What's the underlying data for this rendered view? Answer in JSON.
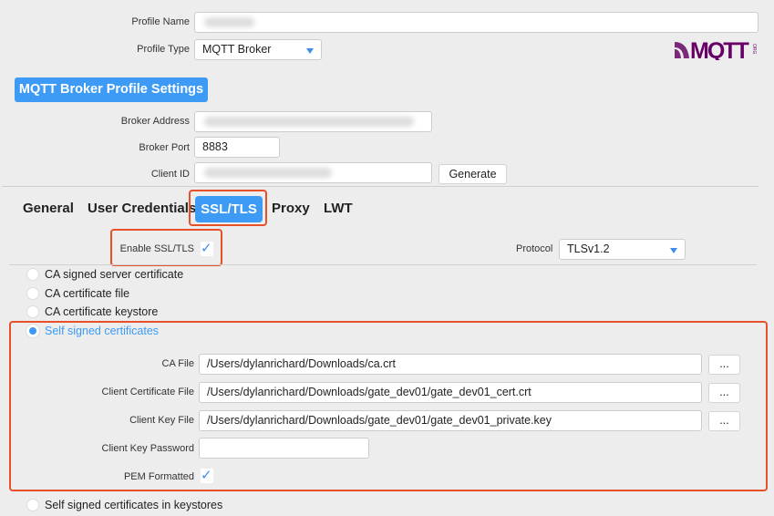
{
  "profile": {
    "name_label": "Profile Name",
    "type_label": "Profile Type",
    "type_value": "MQTT Broker"
  },
  "logo": {
    "text": "MQTT",
    "sub": "ORG",
    "colors": [
      "#660066",
      "#8a2b8a"
    ]
  },
  "section_button": "MQTT Broker Profile Settings",
  "broker": {
    "address_label": "Broker Address",
    "port_label": "Broker Port",
    "port_value": "8883",
    "client_id_label": "Client ID",
    "generate_label": "Generate"
  },
  "tabs": [
    {
      "label": "General"
    },
    {
      "label": "User Credentials"
    },
    {
      "label": "SSL/TLS",
      "active": true
    },
    {
      "label": "Proxy"
    },
    {
      "label": "LWT"
    }
  ],
  "ssl": {
    "enable_label": "Enable SSL/TLS",
    "enabled": true,
    "protocol_label": "Protocol",
    "protocol_value": "TLSv1.2"
  },
  "options": [
    {
      "label": "CA signed server certificate",
      "selected": false
    },
    {
      "label": "CA certificate file",
      "selected": false
    },
    {
      "label": "CA certificate keystore",
      "selected": false
    },
    {
      "label": "Self signed certificates",
      "selected": true
    },
    {
      "label": "Self signed certificates in keystores",
      "selected": false
    }
  ],
  "self_signed": {
    "ca_file_label": "CA File",
    "ca_file": "/Users/dylanrichard/Downloads/ca.crt",
    "client_cert_label": "Client Certificate File",
    "client_cert": "/Users/dylanrichard/Downloads/gate_dev01/gate_dev01_cert.crt",
    "client_key_label": "Client Key File",
    "client_key": "/Users/dylanrichard/Downloads/gate_dev01/gate_dev01_private.key",
    "password_label": "Client Key Password",
    "password": "",
    "pem_label": "PEM Formatted",
    "pem": true,
    "browse_label": "..."
  },
  "colors": {
    "accent": "#3d9bf5",
    "highlight": "#e8502a"
  }
}
